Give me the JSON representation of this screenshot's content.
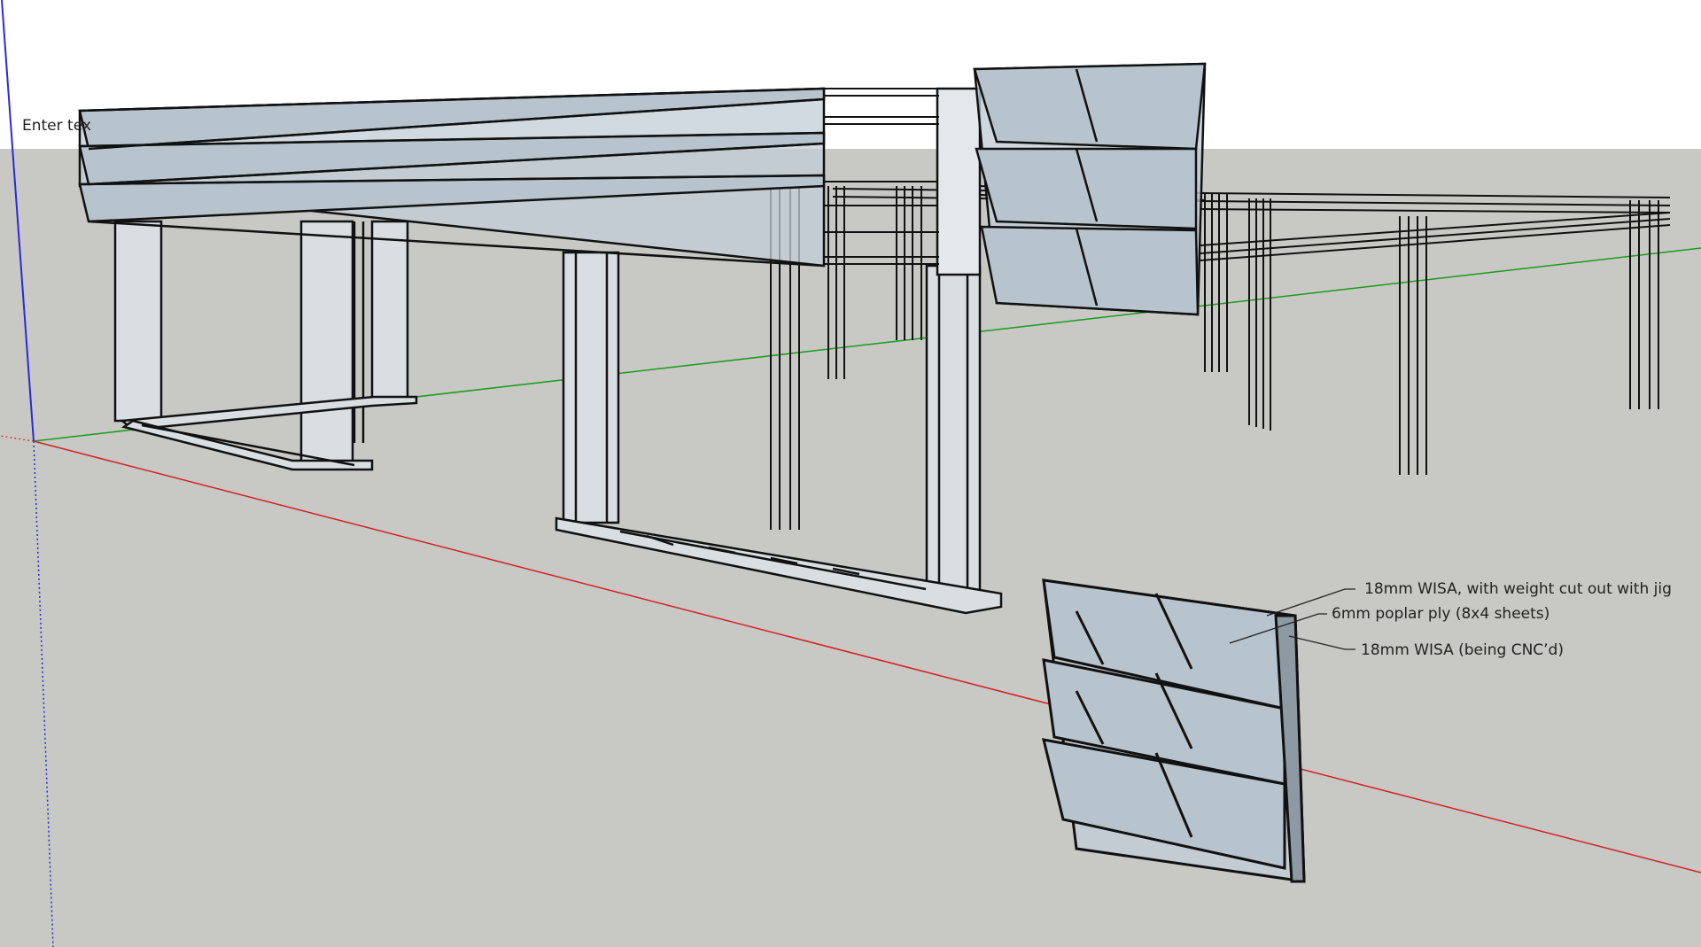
{
  "colors": {
    "sky": "#ffffff",
    "ground": "#c8c8c5",
    "panel_fill": "#c2cdd6",
    "edge": "#111111",
    "axis_red": "#d42020",
    "axis_green": "#1a9c1a",
    "axis_blue": "#2a2ad6"
  },
  "text_tool": {
    "placeholder": "Enter text"
  },
  "annotations": [
    {
      "text": "18mm WISA, with weight cut out with jig"
    },
    {
      "text": "6mm poplar ply (8x4 sheets)"
    },
    {
      "text": "18mm WISA (being CNC’d)"
    }
  ]
}
